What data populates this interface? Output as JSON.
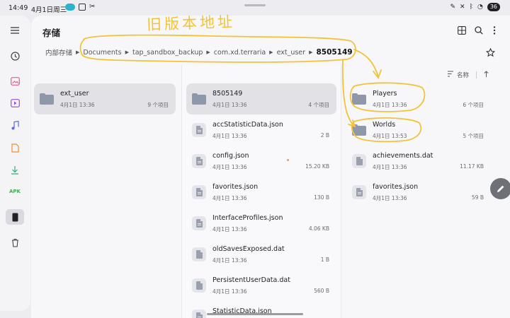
{
  "status_bar": {
    "time": "14:49",
    "date": "4月1日周三",
    "battery": "36"
  },
  "app": {
    "title": "存储"
  },
  "annotation": {
    "text": "旧版本地址"
  },
  "breadcrumb": [
    "内部存储",
    "Documents",
    "tap_sandbox_backup",
    "com.xd.terraria",
    "ext_user",
    "8505149"
  ],
  "sort": {
    "label": "名称"
  },
  "columns": {
    "col1": [
      {
        "name": "ext_user",
        "date": "4月1日 13:36",
        "size": "9 个项目",
        "type": "folder",
        "selected": true
      }
    ],
    "col2": [
      {
        "name": "8505149",
        "date": "4月1日 13:36",
        "size": "4 个项目",
        "type": "folder",
        "selected": true
      },
      {
        "name": "accStatisticData.json",
        "date": "4月1日 13:36",
        "size": "2 B",
        "type": "file"
      },
      {
        "name": "config.json",
        "date": "4月1日 13:36",
        "size": "15.20 KB",
        "type": "file"
      },
      {
        "name": "favorites.json",
        "date": "4月1日 13:36",
        "size": "130 B",
        "type": "file"
      },
      {
        "name": "InterfaceProfiles.json",
        "date": "4月1日 13:36",
        "size": "4.06 KB",
        "type": "file"
      },
      {
        "name": "oldSavesExposed.dat",
        "date": "4月1日 13:36",
        "size": "1 B",
        "type": "file"
      },
      {
        "name": "PersistentUserData.dat",
        "date": "4月1日 13:36",
        "size": "560 B",
        "type": "file"
      },
      {
        "name": "StatisticData.json",
        "date": "",
        "size": "",
        "type": "file"
      }
    ],
    "col3": [
      {
        "name": "Players",
        "date": "4月1日 13:36",
        "size": "6 个项目",
        "type": "folder"
      },
      {
        "name": "Worlds",
        "date": "4月1日 13:53",
        "size": "5 个项目",
        "type": "folder"
      },
      {
        "name": "achievements.dat",
        "date": "4月1日 13:36",
        "size": "11.17 KB",
        "type": "file"
      },
      {
        "name": "favorites.json",
        "date": "4月1日 13:36",
        "size": "59 B",
        "type": "file"
      }
    ]
  },
  "icons": {
    "rail": [
      "menu-icon",
      "recent-icon",
      "images-icon",
      "videos-icon",
      "audio-icon",
      "documents-icon",
      "downloads-icon",
      "apk-icon",
      "device-storage-icon",
      "trash-icon"
    ],
    "header": [
      "grid-view-icon",
      "search-icon",
      "more-icon",
      "star-icon"
    ]
  },
  "rail_labels": {
    "apk": "APK"
  },
  "colors": {
    "annotation": "#f2c33a",
    "folder": "#8f98a8",
    "selected_row": "#e1e1e6"
  }
}
